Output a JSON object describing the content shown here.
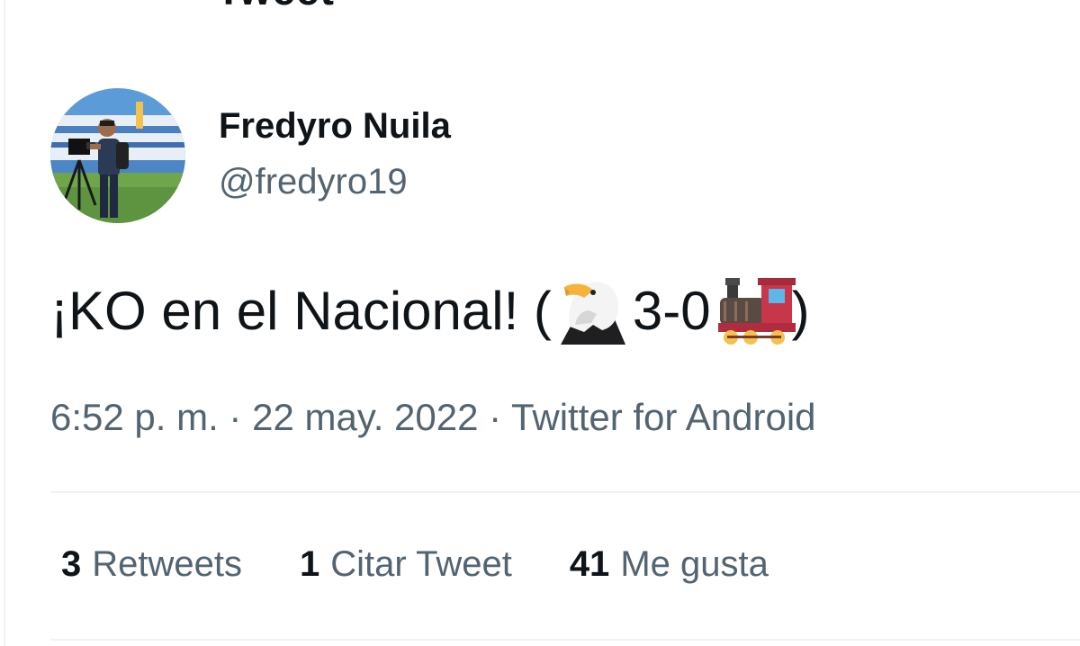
{
  "header": {
    "title": "Tweet"
  },
  "tweet": {
    "author_name": "Fredyro Nuila",
    "author_handle": "@fredyro19",
    "text_before": "¡KO en el Nacional! (",
    "text_score": "3-0",
    "text_after": ")",
    "emoji_1": "eagle-emoji",
    "emoji_2": "locomotive-emoji",
    "meta": "6:52 p. m. · 22 may. 2022 · Twitter for Android"
  },
  "stats": {
    "retweets_count": "3",
    "retweets_label": "Retweets",
    "quotes_count": "1",
    "quotes_label": "Citar Tweet",
    "likes_count": "41",
    "likes_label": "Me gusta"
  },
  "colors": {
    "primary_text": "#0f1419",
    "secondary_text": "#536471",
    "divider": "#eff3f4"
  }
}
